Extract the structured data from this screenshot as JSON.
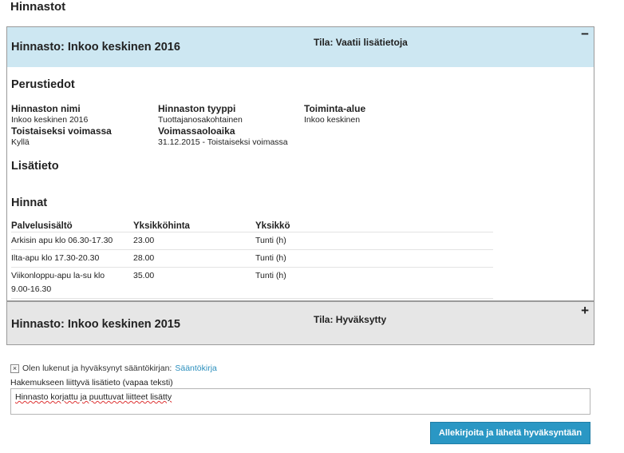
{
  "page": {
    "title": "Hinnastot"
  },
  "pricelists": [
    {
      "title": "Hinnasto: Inkoo keskinen 2016",
      "status": "Tila: Vaatii lisätietoja",
      "toggle": "−",
      "basic": {
        "section_title": "Perustiedot",
        "name_label": "Hinnaston nimi",
        "name_value": "Inkoo keskinen 2016",
        "type_label": "Hinnaston tyyppi",
        "type_value": "Tuottajanosakohtainen",
        "area_label": "Toiminta-alue",
        "area_value": "Inkoo keskinen",
        "valid_label": "Toistaiseksi voimassa",
        "valid_value": "Kyllä",
        "period_label": "Voimassaoloaika",
        "period_value": "31.12.2015 - Toistaiseksi voimassa"
      },
      "extra_section_title": "Lisätieto",
      "prices": {
        "section_title": "Hinnat",
        "columns": [
          "Palvelusisältö",
          "Yksikköhinta",
          "Yksikkö"
        ],
        "rows": [
          [
            "Arkisin apu klo 06.30-17.30",
            "23.00",
            "Tunti (h)"
          ],
          [
            "Ilta-apu klo 17.30-20.30",
            "28.00",
            "Tunti (h)"
          ],
          [
            "Viikonloppu-apu la-su klo 9.00-16.30",
            "35.00",
            "Tunti (h)"
          ]
        ]
      }
    },
    {
      "title": "Hinnasto: Inkoo keskinen 2015",
      "status": "Tila: Hyväksytty",
      "toggle": "+"
    }
  ],
  "rules": {
    "checked_mark": "×",
    "label": "Olen lukenut ja hyväksynyt sääntökirjan:",
    "link": "Sääntökirja"
  },
  "extra_info": {
    "label": "Hakemukseen liittyvä lisätieto (vapaa teksti)",
    "value": "Hinnasto korjattu ja puuttuvat liitteet lisätty"
  },
  "submit_label": "Allekirjoita ja lähetä hyväksyntään"
}
